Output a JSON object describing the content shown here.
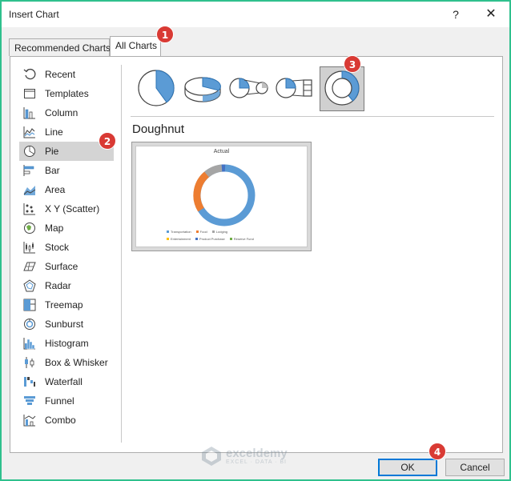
{
  "window": {
    "title": "Insert Chart",
    "help_label": "?",
    "close_label": "✕"
  },
  "tabs": [
    {
      "label": "Recommended Charts",
      "active": false
    },
    {
      "label": "All Charts",
      "active": true
    }
  ],
  "nav": {
    "items": [
      {
        "label": "Recent",
        "icon": "recent-icon"
      },
      {
        "label": "Templates",
        "icon": "templates-icon"
      },
      {
        "label": "Column",
        "icon": "column-chart-icon"
      },
      {
        "label": "Line",
        "icon": "line-chart-icon"
      },
      {
        "label": "Pie",
        "icon": "pie-chart-icon",
        "selected": true
      },
      {
        "label": "Bar",
        "icon": "bar-chart-icon"
      },
      {
        "label": "Area",
        "icon": "area-chart-icon"
      },
      {
        "label": "X Y (Scatter)",
        "icon": "scatter-chart-icon"
      },
      {
        "label": "Map",
        "icon": "map-chart-icon"
      },
      {
        "label": "Stock",
        "icon": "stock-chart-icon"
      },
      {
        "label": "Surface",
        "icon": "surface-chart-icon"
      },
      {
        "label": "Radar",
        "icon": "radar-chart-icon"
      },
      {
        "label": "Treemap",
        "icon": "treemap-chart-icon"
      },
      {
        "label": "Sunburst",
        "icon": "sunburst-chart-icon"
      },
      {
        "label": "Histogram",
        "icon": "histogram-chart-icon"
      },
      {
        "label": "Box & Whisker",
        "icon": "box-whisker-chart-icon"
      },
      {
        "label": "Waterfall",
        "icon": "waterfall-chart-icon"
      },
      {
        "label": "Funnel",
        "icon": "funnel-chart-icon"
      },
      {
        "label": "Combo",
        "icon": "combo-chart-icon"
      }
    ]
  },
  "subtypes": {
    "items": [
      "pie-icon",
      "3d-pie-icon",
      "pie-of-pie-icon",
      "bar-of-pie-icon",
      "doughnut-icon"
    ],
    "selected": "doughnut-icon",
    "selected_title": "Doughnut"
  },
  "preview": {
    "title": "Actual",
    "legend": [
      {
        "label": "Transportation",
        "color": "#5b9bd5"
      },
      {
        "label": "Food",
        "color": "#ed7d31"
      },
      {
        "label": "Lodging",
        "color": "#a5a5a5"
      },
      {
        "label": "Entertainment",
        "color": "#ffc000"
      },
      {
        "label": "Product Purchase",
        "color": "#4472c4"
      },
      {
        "label": "Reserve Fund",
        "color": "#70ad47"
      }
    ]
  },
  "badges": [
    "1",
    "2",
    "3",
    "4"
  ],
  "watermark": {
    "name": "exceldemy",
    "sub": "EXCEL · DATA · BI"
  },
  "buttons": {
    "ok": "OK",
    "cancel": "Cancel"
  },
  "colors": {
    "accent": "#0078d7",
    "badge": "#d93a34",
    "frame": "#2fc08d",
    "pie_blue": "#5b9bd5"
  }
}
